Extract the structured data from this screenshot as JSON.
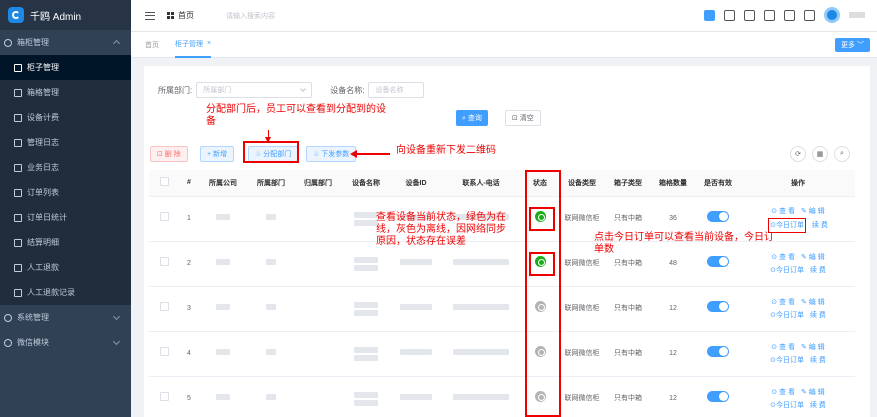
{
  "app": {
    "title": "千鸥 Admin"
  },
  "sidebar": {
    "group_label": "箱柜管理",
    "sub_items": [
      {
        "label": "柜子管理",
        "icon": "monitor-icon",
        "active": true
      },
      {
        "label": "箱格管理",
        "icon": "image-icon"
      },
      {
        "label": "设备计费",
        "icon": "document-icon"
      },
      {
        "label": "管理日志",
        "icon": "edit-icon"
      },
      {
        "label": "业务日志",
        "icon": "edit-icon"
      },
      {
        "label": "订单列表",
        "icon": "list-icon"
      },
      {
        "label": "订单日统计",
        "icon": "calendar-icon"
      },
      {
        "label": "结算明细",
        "icon": "edit-icon"
      },
      {
        "label": "人工退款",
        "icon": "grid-icon"
      },
      {
        "label": "人工退款记录",
        "icon": "users-icon"
      }
    ],
    "bottom_groups": [
      {
        "label": "系统管理",
        "icon": "users-icon"
      },
      {
        "label": "微信模块",
        "icon": "wechat-icon"
      }
    ]
  },
  "navbar": {
    "breadcrumb_home": "首页",
    "search_placeholder": "请输入搜索内容"
  },
  "tags": {
    "items": [
      {
        "label": "首页"
      },
      {
        "label": "柜子管理"
      }
    ],
    "close": "×",
    "more_label": "更多 ﹀"
  },
  "filters": {
    "dept_label": "所属部门:",
    "dept_placeholder": "所属部门",
    "device_label": "设备名称:",
    "device_placeholder": "设备名称",
    "query_label": "⌕ 查询",
    "clear_label": "⊡ 清空"
  },
  "toolbar": {
    "delete_label": "⊡ 删 除",
    "add_label": "+ 新增",
    "assign_label": "♧ 分配部门",
    "send_label": "♧ 下发参数",
    "right_icons": [
      "⟳",
      "▦",
      "⌕"
    ]
  },
  "table": {
    "headers": [
      "",
      "#",
      "所属公司",
      "所属部门",
      "归属部门",
      "设备名称",
      "设备ID",
      "联系人-电话",
      "状态",
      "设备类型",
      "箱子类型",
      "箱格数量",
      "是否有效",
      "操作"
    ],
    "rows": [
      {
        "index": "1",
        "status": "online",
        "device_type": "联网微信柜",
        "box_type": "只有中箱",
        "count": "36",
        "enabled": true
      },
      {
        "index": "2",
        "status": "online",
        "device_type": "联网微信柜",
        "box_type": "只有中箱",
        "count": "48",
        "enabled": true
      },
      {
        "index": "3",
        "status": "offline",
        "device_type": "联网微信柜",
        "box_type": "只有中箱",
        "count": "12",
        "enabled": true
      },
      {
        "index": "4",
        "status": "offline",
        "device_type": "联网微信柜",
        "box_type": "只有中箱",
        "count": "12",
        "enabled": true
      },
      {
        "index": "5",
        "status": "offline",
        "device_type": "联网微信柜",
        "box_type": "只有中箱",
        "count": "12",
        "enabled": true
      }
    ],
    "ops": {
      "view": "⊙ 查 看",
      "edit": "✎ 编 辑",
      "today_orders": "⊙今日订单",
      "renew": "续 费"
    }
  },
  "annotations": {
    "assign_note": "分配部门后，员工可以查看到分配到的设备",
    "send_note": "向设备重新下发二维码",
    "status_note": "查看设备当前状态，绿色为在线，灰色为离线，因网络同步原因，状态存在误差",
    "orders_note": "点击今日订单可以查看当前设备，今日订单数"
  },
  "colors": {
    "primary": "#409eff",
    "sidebar_bg": "#304156",
    "annotation": "#ee0000",
    "online": "#1aad19",
    "offline": "#b4b4b4"
  }
}
